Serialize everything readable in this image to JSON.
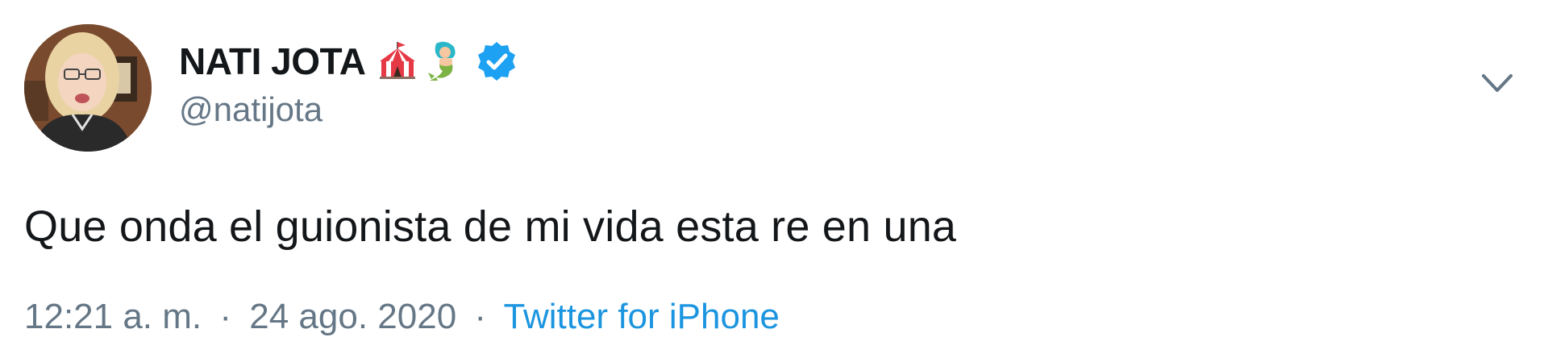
{
  "tweet": {
    "author": {
      "display_name": "NATI JOTA",
      "handle": "@natijota",
      "emojis": [
        "circus-tent-icon",
        "mermaid-icon"
      ],
      "verified_icon": "verified-badge-icon"
    },
    "text": "Que onda el guionista de mi vida esta re en una",
    "meta": {
      "time": "12:21 a. m.",
      "separator": "·",
      "date": "24 ago. 2020",
      "source": "Twitter for iPhone"
    },
    "menu_icon": "chevron-down-icon"
  },
  "colors": {
    "text_primary": "#14171a",
    "text_secondary": "#657786",
    "link": "#1b95e0",
    "verified": "#1da1f2"
  }
}
